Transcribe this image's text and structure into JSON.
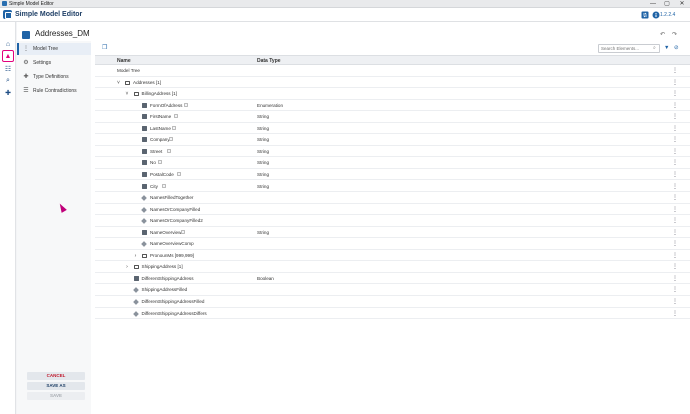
{
  "window": {
    "title": "Simple Model Editor",
    "controls": [
      "—",
      "▢",
      "✕"
    ]
  },
  "header": {
    "app_title": "Simple Model Editor",
    "version": "1.2.2.4"
  },
  "leftbar": {
    "icons": [
      "home-icon",
      "model-icon",
      "hierarchy-icon",
      "search-icon",
      "puzzle-icon"
    ]
  },
  "document": {
    "title": "Addresses_DM"
  },
  "nav": {
    "items": [
      {
        "label": "Model Tree",
        "icon": "tree-icon"
      },
      {
        "label": "Settings",
        "icon": "gear-icon"
      },
      {
        "label": "Type Definitions",
        "icon": "puzzle-icon"
      },
      {
        "label": "Rule Contradictions",
        "icon": "list-icon"
      }
    ]
  },
  "buttons": {
    "cancel": "CANCEL",
    "save_as": "SAVE AS",
    "save": "SAVE"
  },
  "search": {
    "placeholder": "Search Elements..."
  },
  "table": {
    "columns": [
      "Name",
      "Data Type"
    ],
    "rows": [
      {
        "name": "Model Tree",
        "type": "",
        "kind": "root",
        "level": 0,
        "expander": "",
        "badge": false
      },
      {
        "name": "Addresses [1]",
        "type": "",
        "kind": "folder",
        "level": 1,
        "expander": "˅",
        "badge": false
      },
      {
        "name": "BillingAddress [1]",
        "type": "",
        "kind": "folder",
        "level": 2,
        "expander": "˅",
        "badge": false
      },
      {
        "name": "FormOfAddress",
        "type": "Enumeration",
        "kind": "attr",
        "level": 3,
        "expander": "",
        "badge": true
      },
      {
        "name": "FirstName",
        "type": "String",
        "kind": "attr",
        "level": 3,
        "expander": "",
        "badge": true
      },
      {
        "name": "LastName",
        "type": "String",
        "kind": "attr",
        "level": 3,
        "expander": "",
        "badge": true
      },
      {
        "name": "Company",
        "type": "String",
        "kind": "attr",
        "level": 3,
        "expander": "",
        "badge": true
      },
      {
        "name": "Street",
        "type": "String",
        "kind": "attr",
        "level": 3,
        "expander": "",
        "badge": true
      },
      {
        "name": "No",
        "type": "String",
        "kind": "attr",
        "level": 3,
        "expander": "",
        "badge": true
      },
      {
        "name": "PostalCode",
        "type": "String",
        "kind": "attr",
        "level": 3,
        "expander": "",
        "badge": true
      },
      {
        "name": "City",
        "type": "String",
        "kind": "attr",
        "level": 3,
        "expander": "",
        "badge": true
      },
      {
        "name": "NamesFilledTogether",
        "type": "",
        "kind": "rule",
        "level": 3,
        "expander": "",
        "badge": false
      },
      {
        "name": "NamesOrCompanyFilled",
        "type": "",
        "kind": "rule",
        "level": 3,
        "expander": "",
        "badge": false
      },
      {
        "name": "NamesOrCompanyFilled2",
        "type": "",
        "kind": "rule",
        "level": 3,
        "expander": "",
        "badge": false
      },
      {
        "name": "NameOverview",
        "type": "String",
        "kind": "attr",
        "level": 3,
        "expander": "",
        "badge": true
      },
      {
        "name": "NameOverviewComp",
        "type": "",
        "kind": "rule",
        "level": 3,
        "expander": "",
        "badge": false
      },
      {
        "name": "PronounMs [999,999]",
        "type": "",
        "kind": "folder",
        "level": 3,
        "expander": "›",
        "badge": false
      },
      {
        "name": "ShippingAddress [1]",
        "type": "",
        "kind": "folder",
        "level": 2,
        "expander": "›",
        "badge": false
      },
      {
        "name": "DifferentShippingAddress",
        "type": "Boolean",
        "kind": "attr",
        "level": 2,
        "expander": "",
        "badge": false
      },
      {
        "name": "ShippingAddressFilled",
        "type": "",
        "kind": "rule",
        "level": 2,
        "expander": "",
        "badge": false
      },
      {
        "name": "DifferentShippingAddressFilled",
        "type": "",
        "kind": "rule",
        "level": 2,
        "expander": "",
        "badge": false
      },
      {
        "name": "DifferentShippingAddressDiffers",
        "type": "",
        "kind": "rule",
        "level": 2,
        "expander": "",
        "badge": false
      }
    ]
  },
  "colors": {
    "accent": "#1f63a6",
    "active_nav": "#e3007d",
    "cancel_text": "#c0172b"
  }
}
